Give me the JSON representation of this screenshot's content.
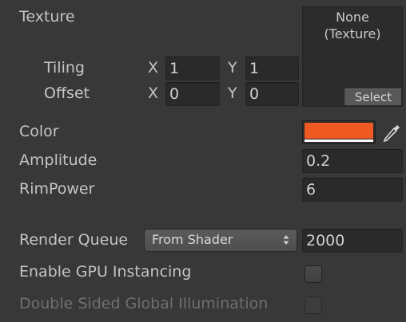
{
  "texture": {
    "label": "Texture",
    "slot_line1": "None",
    "slot_line2": "(Texture)",
    "select_label": "Select",
    "tiling": {
      "label": "Tiling",
      "x_label": "X",
      "x_value": "1",
      "y_label": "Y",
      "y_value": "1"
    },
    "offset": {
      "label": "Offset",
      "x_label": "X",
      "x_value": "0",
      "y_label": "Y",
      "y_value": "0"
    }
  },
  "color": {
    "label": "Color",
    "value": "#ef5a22",
    "picker_icon": "eyedropper-icon"
  },
  "amplitude": {
    "label": "Amplitude",
    "value": "0.2"
  },
  "rimpower": {
    "label": "RimPower",
    "value": "6"
  },
  "render_queue": {
    "label": "Render Queue",
    "selected": "From Shader",
    "value": "2000"
  },
  "gpu_instancing": {
    "label": "Enable GPU Instancing",
    "checked": false
  },
  "double_sided_gi": {
    "label": "Double Sided Global Illumination",
    "checked": false,
    "disabled": true
  }
}
